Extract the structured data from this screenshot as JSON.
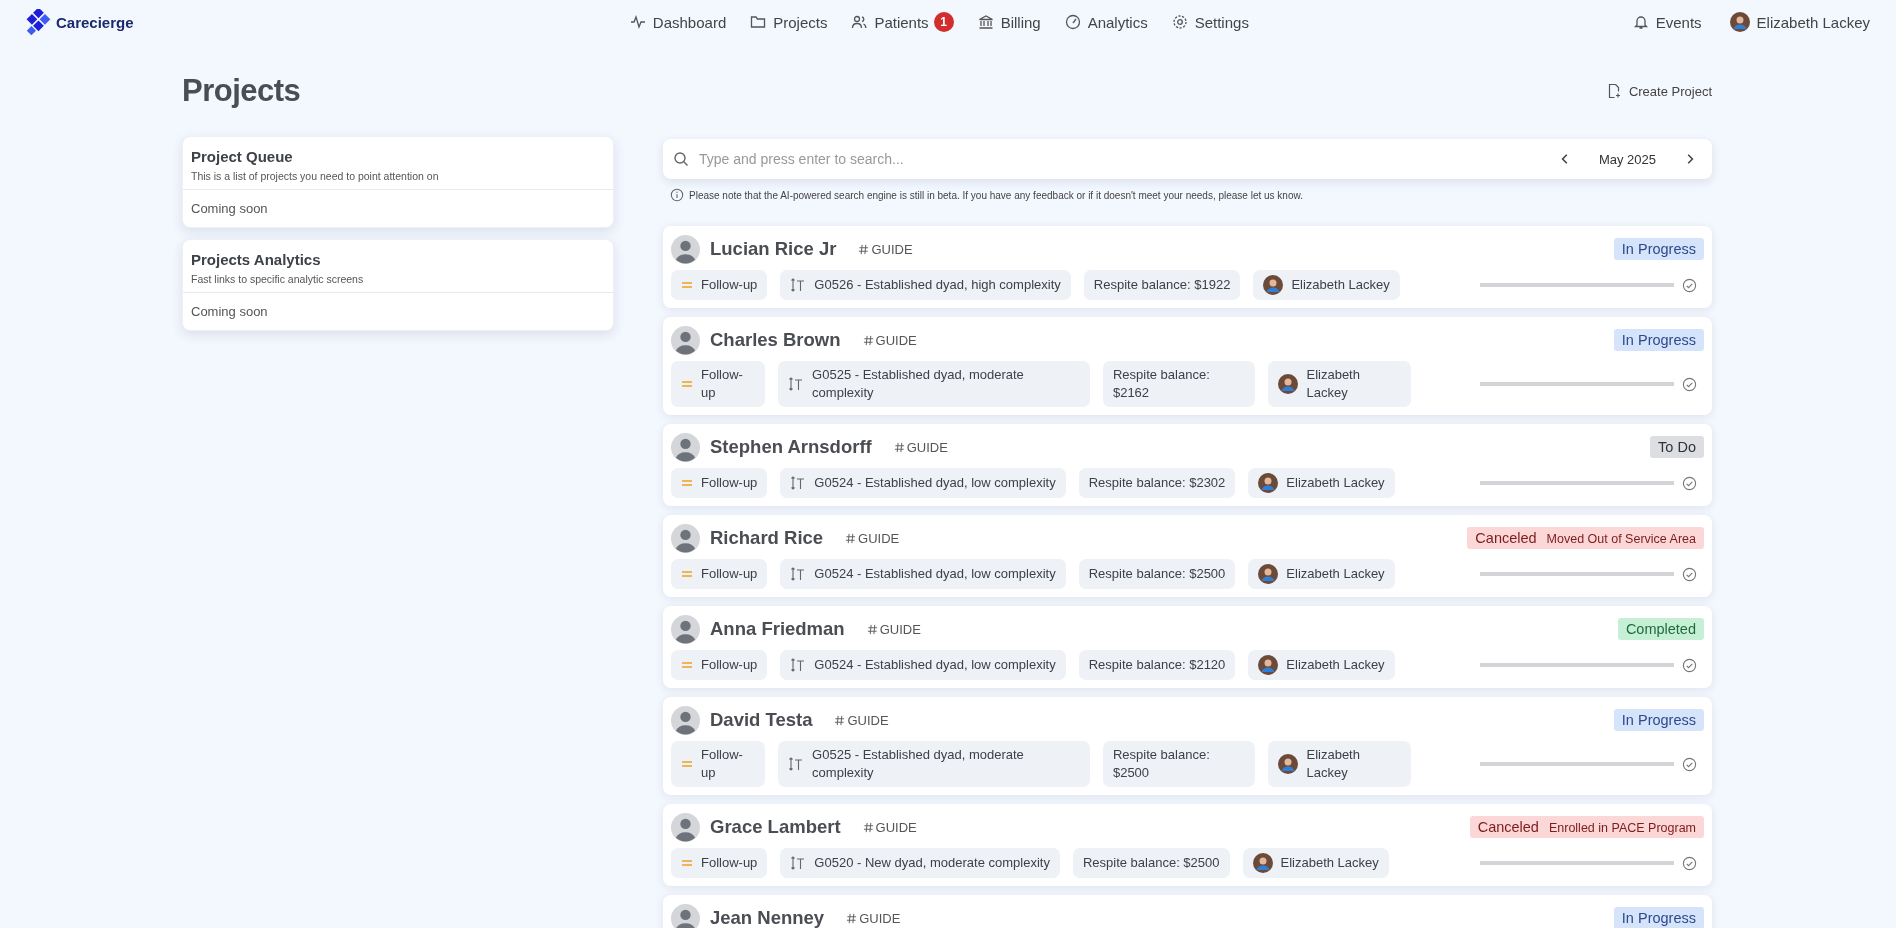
{
  "brand": "Carecierge",
  "nav": [
    {
      "label": "Dashboard",
      "selected": false
    },
    {
      "label": "Projects",
      "selected": false
    },
    {
      "label": "Patients",
      "selected": false,
      "badge": "1"
    },
    {
      "label": "Billing",
      "selected": false
    },
    {
      "label": "Analytics",
      "selected": false
    },
    {
      "label": "Settings",
      "selected": false
    }
  ],
  "events": "Events",
  "user": "Elizabeth Lackey",
  "page_title": "Projects",
  "create_button": "Create Project",
  "side_cards": [
    {
      "title": "Project Queue",
      "description": "This is a list of projects you need to point attention on",
      "body": "Coming soon"
    },
    {
      "title": "Projects Analytics",
      "description": "Fast links to specific analytic screens",
      "body": "Coming soon"
    }
  ],
  "search": {
    "placeholder": "Type and press enter to search...",
    "month": "May 2025"
  },
  "notice": "Please note that the AI-powered search engine is still in beta. If you have any feedback or if it doesn't meet your needs, please let us know.",
  "projects": [
    {
      "name": "Lucian Rice Jr",
      "tag": "GUIDE",
      "status": {
        "kind": "in_progress",
        "label": "In Progress"
      },
      "type": "Follow-up",
      "code": "G0526 - Established dyad, high complexity",
      "balance": "Respite balance: $1922",
      "assignee": "Elizabeth Lackey"
    },
    {
      "name": "Charles Brown",
      "tag": "GUIDE",
      "status": {
        "kind": "in_progress",
        "label": "In Progress"
      },
      "type": "Follow-up",
      "code": "G0525 - Established dyad, moderate complexity",
      "balance": "Respite balance: $2162",
      "assignee": "Elizabeth Lackey"
    },
    {
      "name": "Stephen Arnsdorff",
      "tag": "GUIDE",
      "status": {
        "kind": "todo",
        "label": "To Do"
      },
      "type": "Follow-up",
      "code": "G0524 - Established dyad, low complexity",
      "balance": "Respite balance: $2302",
      "assignee": "Elizabeth Lackey"
    },
    {
      "name": "Richard Rice",
      "tag": "GUIDE",
      "status": {
        "kind": "canceled",
        "label": "Canceled",
        "reason": "Moved Out of Service Area"
      },
      "type": "Follow-up",
      "code": "G0524 - Established dyad, low complexity",
      "balance": "Respite balance: $2500",
      "assignee": "Elizabeth Lackey"
    },
    {
      "name": "Anna Friedman",
      "tag": "GUIDE",
      "status": {
        "kind": "completed",
        "label": "Completed"
      },
      "type": "Follow-up",
      "code": "G0524 - Established dyad, low complexity",
      "balance": "Respite balance: $2120",
      "assignee": "Elizabeth Lackey"
    },
    {
      "name": "David Testa",
      "tag": "GUIDE",
      "status": {
        "kind": "in_progress",
        "label": "In Progress"
      },
      "type": "Follow-up",
      "code": "G0525 - Established dyad, moderate complexity",
      "balance": "Respite balance: $2500",
      "assignee": "Elizabeth Lackey"
    },
    {
      "name": "Grace Lambert",
      "tag": "GUIDE",
      "status": {
        "kind": "canceled",
        "label": "Canceled",
        "reason": "Enrolled in PACE Program"
      },
      "type": "Follow-up",
      "code": "G0520 - New dyad, moderate complexity",
      "balance": "Respite balance: $2500",
      "assignee": "Elizabeth Lackey"
    },
    {
      "name": "Jean Nenney",
      "tag": "GUIDE",
      "status": {
        "kind": "in_progress",
        "label": "In Progress"
      }
    }
  ]
}
